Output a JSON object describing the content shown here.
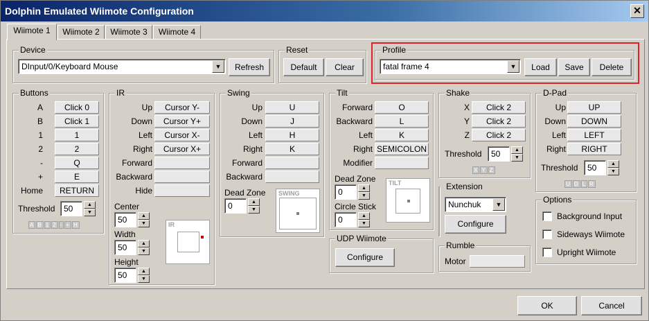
{
  "window": {
    "title": "Dolphin Emulated Wiimote Configuration",
    "close_glyph": "✕"
  },
  "tabs": [
    "Wiimote 1",
    "Wiimote 2",
    "Wiimote 3",
    "Wiimote 4"
  ],
  "device": {
    "title": "Device",
    "value": "DInput/0/Keyboard Mouse",
    "refresh": "Refresh"
  },
  "reset": {
    "title": "Reset",
    "default": "Default",
    "clear": "Clear"
  },
  "profile": {
    "title": "Profile",
    "value": "fatal frame 4",
    "load": "Load",
    "save": "Save",
    "delete": "Delete",
    "highlight_color": "#e0202a"
  },
  "buttons": {
    "title": "Buttons",
    "rows": [
      [
        "A",
        "Click 0"
      ],
      [
        "B",
        "Click 1"
      ],
      [
        "1",
        "1"
      ],
      [
        "2",
        "2"
      ],
      [
        "-",
        "Q"
      ],
      [
        "+",
        "E"
      ],
      [
        "Home",
        "RETURN"
      ]
    ],
    "threshold_label": "Threshold",
    "threshold": "50",
    "indicators": [
      "A",
      "B",
      "1",
      "2",
      "-",
      "+",
      "H"
    ]
  },
  "ir": {
    "title": "IR",
    "rows": [
      [
        "Up",
        "Cursor Y-"
      ],
      [
        "Down",
        "Cursor Y+"
      ],
      [
        "Left",
        "Cursor X-"
      ],
      [
        "Right",
        "Cursor X+"
      ],
      [
        "Forward",
        ""
      ],
      [
        "Backward",
        ""
      ],
      [
        "Hide",
        ""
      ]
    ],
    "center_label": "Center",
    "center": "50",
    "width_label": "Width",
    "width": "50",
    "height_label": "Height",
    "height": "50",
    "stick_label": "IR"
  },
  "swing": {
    "title": "Swing",
    "rows": [
      [
        "Up",
        "U"
      ],
      [
        "Down",
        "J"
      ],
      [
        "Left",
        "H"
      ],
      [
        "Right",
        "K"
      ],
      [
        "Forward",
        ""
      ],
      [
        "Backward",
        ""
      ]
    ],
    "deadzone_label": "Dead Zone",
    "deadzone": "0",
    "stick_label": "SWING"
  },
  "tilt": {
    "title": "Tilt",
    "rows": [
      [
        "Forward",
        "O"
      ],
      [
        "Backward",
        "L"
      ],
      [
        "Left",
        "K"
      ],
      [
        "Right",
        "SEMICOLON"
      ],
      [
        "Modifier",
        ""
      ]
    ],
    "deadzone_label": "Dead Zone",
    "deadzone": "0",
    "circle_label": "Circle Stick",
    "circle": "0",
    "stick_label": "TILT"
  },
  "udp": {
    "title": "UDP Wiimote",
    "configure": "Configure"
  },
  "shake": {
    "title": "Shake",
    "rows": [
      [
        "X",
        "Click 2"
      ],
      [
        "Y",
        "Click 2"
      ],
      [
        "Z",
        "Click 2"
      ]
    ],
    "threshold_label": "Threshold",
    "threshold": "50",
    "indicators": [
      "X",
      "Y",
      "Z"
    ]
  },
  "extension": {
    "title": "Extension",
    "value": "Nunchuk",
    "configure": "Configure"
  },
  "rumble": {
    "title": "Rumble",
    "motor_label": "Motor",
    "motor": ""
  },
  "dpad": {
    "title": "D-Pad",
    "rows": [
      [
        "Up",
        "UP"
      ],
      [
        "Down",
        "DOWN"
      ],
      [
        "Left",
        "LEFT"
      ],
      [
        "Right",
        "RIGHT"
      ]
    ],
    "threshold_label": "Threshold",
    "threshold": "50",
    "indicators": [
      "U",
      "D",
      "L",
      "R"
    ]
  },
  "options": {
    "title": "Options",
    "items": [
      "Background Input",
      "Sideways Wiimote",
      "Upright Wiimote"
    ]
  },
  "footer": {
    "ok": "OK",
    "cancel": "Cancel"
  }
}
